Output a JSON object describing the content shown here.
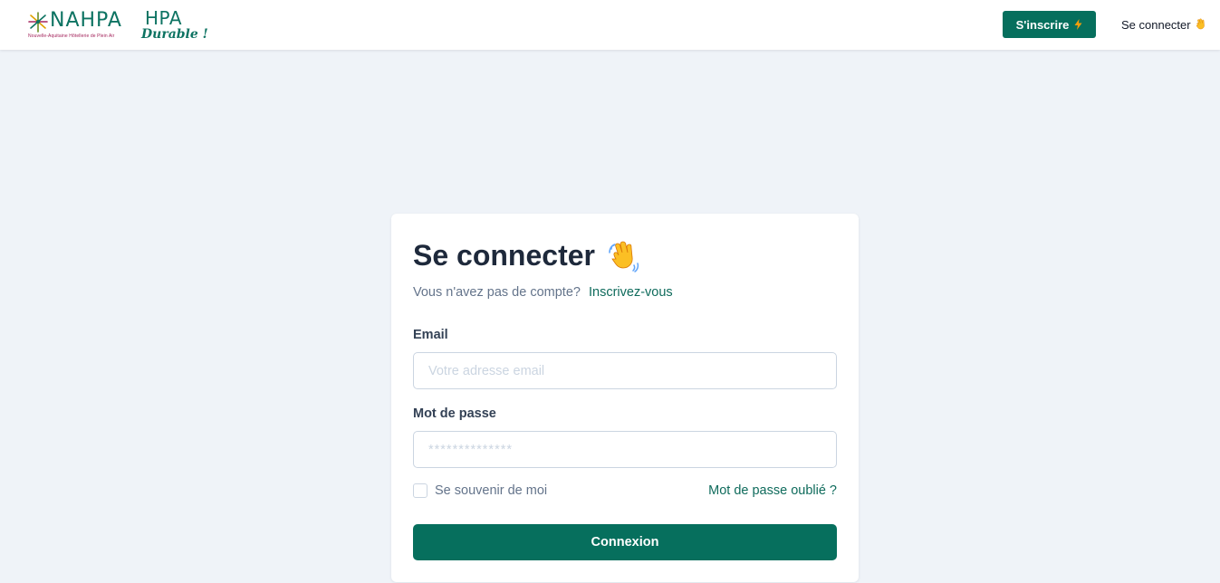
{
  "header": {
    "logo_text": "NAHPA",
    "logo_tagline": "Nouvelle-Aquitaine Hôtellerie de Plein Air",
    "logo2_top": "HPA",
    "logo2_bottom": "Durable !",
    "signup_label": "S'inscrire",
    "signup_icon": "bolt-icon",
    "login_label": "Se connecter",
    "login_icon": "waving-hand-icon"
  },
  "form": {
    "title": "Se connecter",
    "title_icon": "waving-hand-icon",
    "subtitle": "Vous n'avez pas de compte?",
    "signup_link": "Inscrivez-vous",
    "email_label": "Email",
    "email_placeholder": "Votre adresse email",
    "email_value": "",
    "password_label": "Mot de passe",
    "password_placeholder": "**************",
    "password_value": "",
    "remember_label": "Se souvenir de moi",
    "remember_checked": false,
    "forgot_label": "Mot de passe oublié ?",
    "submit_label": "Connexion"
  },
  "colors": {
    "brand": "#066f5d",
    "background": "#eff3f8",
    "logo_accent": "#a3235b",
    "bolt": "#f59e0b",
    "wave": "#fbbf24"
  }
}
